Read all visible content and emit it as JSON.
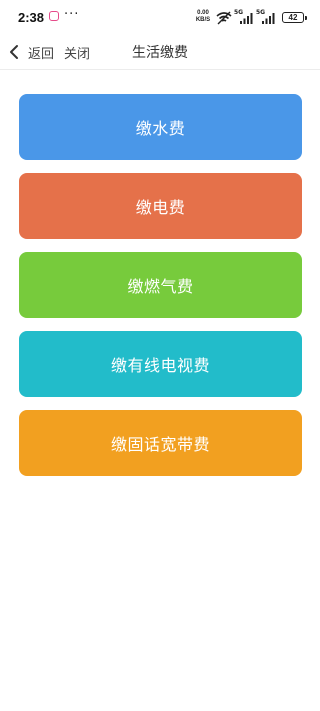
{
  "status_bar": {
    "time": "2:38",
    "dots": "···",
    "net_speed_value": "0.00",
    "net_speed_unit": "KB/S",
    "sig1_label": "5G",
    "sig2_label": "5G",
    "battery": "42",
    "icons": [
      "notification-icon",
      "wifi-icon",
      "signal-icon",
      "signal-icon",
      "battery-icon"
    ]
  },
  "nav": {
    "back_label": "返回",
    "close_label": "关闭",
    "title": "生活缴费"
  },
  "buttons": [
    {
      "label": "缴水费",
      "color": "#4a97e8"
    },
    {
      "label": "缴电费",
      "color": "#e5714a"
    },
    {
      "label": "缴燃气费",
      "color": "#77cb3c"
    },
    {
      "label": "缴有线电视费",
      "color": "#22bcca"
    },
    {
      "label": "缴固话宽带费",
      "color": "#f2a020"
    }
  ]
}
